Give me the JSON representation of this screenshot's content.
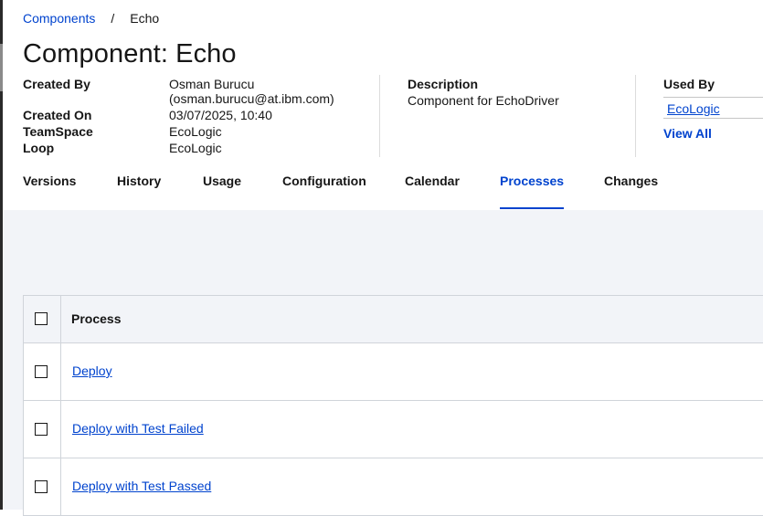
{
  "breadcrumb": {
    "parent": "Components",
    "separator": "/",
    "current": "Echo"
  },
  "page_title": "Component: Echo",
  "details": {
    "created_by_label": "Created By",
    "created_by_name": "Osman Burucu",
    "created_by_email": "(osman.burucu@at.ibm.com)",
    "created_on_label": "Created On",
    "created_on_value": "03/07/2025, 10:40",
    "teamspace_label": "TeamSpace",
    "teamspace_value": "EcoLogic",
    "loop_label": "Loop",
    "loop_value": "EcoLogic",
    "description_label": "Description",
    "description_value": "Component for EchoDriver",
    "used_by_label": "Used By",
    "used_by_items": [
      "EcoLogic"
    ],
    "view_all_label": "View All"
  },
  "tabs": [
    {
      "label": "Versions",
      "active": false
    },
    {
      "label": "History",
      "active": false
    },
    {
      "label": "Usage",
      "active": false
    },
    {
      "label": "Configuration",
      "active": false
    },
    {
      "label": "Calendar",
      "active": false
    },
    {
      "label": "Processes",
      "active": true
    },
    {
      "label": "Changes",
      "active": false
    }
  ],
  "table": {
    "header": "Process",
    "rows": [
      {
        "name": "Deploy"
      },
      {
        "name": "Deploy with Test Failed"
      },
      {
        "name": "Deploy with Test Passed"
      }
    ]
  },
  "colors": {
    "link": "#0043ce",
    "table_header_bg": "#f2f4f8",
    "content_bg": "#f2f4f8"
  }
}
